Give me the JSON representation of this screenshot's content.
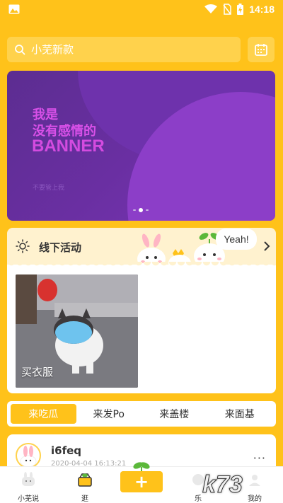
{
  "status_bar": {
    "time": "14:18"
  },
  "search": {
    "placeholder": "小芜新款"
  },
  "banner": {
    "line1": "我是",
    "line2": "没有感情的",
    "big_text": "BANNER",
    "subtext": "不要管上我"
  },
  "activity": {
    "title": "线下活动",
    "speech": "Yeah!",
    "card_caption": "买衣服"
  },
  "tabs": [
    {
      "label": "来吃瓜",
      "active": true
    },
    {
      "label": "来发Po",
      "active": false
    },
    {
      "label": "来盖楼",
      "active": false
    },
    {
      "label": "来面基",
      "active": false
    }
  ],
  "post": {
    "username": "i6feq",
    "time": "2020-04-04 16:13:21",
    "more": "···"
  },
  "bottom_nav": {
    "items": [
      {
        "label": "小芜说",
        "icon": "bunny-icon"
      },
      {
        "label": "逛",
        "icon": "box-icon"
      },
      {
        "label": "+",
        "icon": "add-icon"
      },
      {
        "label": "乐",
        "icon": "fun-icon"
      },
      {
        "label": "我的",
        "icon": "profile-icon"
      }
    ]
  },
  "watermark": "k73",
  "colors": {
    "accent": "#FFC21A",
    "banner": "#6A2FA2",
    "banner_text": "#D44BE0"
  }
}
